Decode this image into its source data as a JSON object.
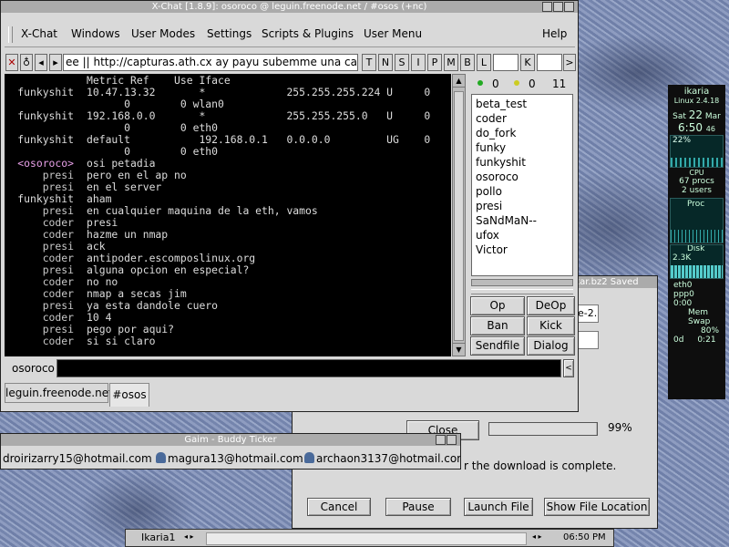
{
  "xchat": {
    "title": "X-Chat [1.8.9]: osoroco @ leguin.freenode.net / #osos (+nc)",
    "menu": [
      "X-Chat",
      "Windows",
      "User Modes",
      "Settings",
      "Scripts & Plugins",
      "User Menu",
      "Help"
    ],
    "topic": "ee || http://capturas.ath.cx ay payu subemme una castural",
    "mode_buttons": [
      "T",
      "N",
      "S",
      "I",
      "P",
      "M",
      "B",
      "L",
      "K"
    ],
    "arrow_right": ">",
    "route_lines": [
      {
        "nick": "",
        "text": "Metric Ref    Use Iface"
      },
      {
        "nick": "funkyshit",
        "text": "10.47.13.32       *             255.255.255.224 U     0"
      },
      {
        "nick": "",
        "text": "      0        0 wlan0"
      },
      {
        "nick": "funkyshit",
        "text": "192.168.0.0       *             255.255.255.0   U     0"
      },
      {
        "nick": "",
        "text": "      0        0 eth0"
      },
      {
        "nick": "funkyshit",
        "text": "default           192.168.0.1   0.0.0.0         UG    0"
      },
      {
        "nick": "",
        "text": "      0        0 eth0"
      }
    ],
    "chat_lines": [
      {
        "nick": "<osoroco>",
        "text": "osi petadia"
      },
      {
        "nick": "presi",
        "text": "pero en el ap no"
      },
      {
        "nick": "presi",
        "text": "en el server"
      },
      {
        "nick": "funkyshit",
        "text": "aham"
      },
      {
        "nick": "presi",
        "text": "en cualquier maquina de la eth, vamos"
      },
      {
        "nick": "coder",
        "text": "presi"
      },
      {
        "nick": "coder",
        "text": "hazme un nmap"
      },
      {
        "nick": "presi",
        "text": "ack"
      },
      {
        "nick": "coder",
        "text": "antipoder.escomposlinux.org"
      },
      {
        "nick": "presi",
        "text": "alguna opcion en especial?"
      },
      {
        "nick": "coder",
        "text": "no no"
      },
      {
        "nick": "coder",
        "text": "nmap a secas jim"
      },
      {
        "nick": "presi",
        "text": "ya esta dandole cuero"
      },
      {
        "nick": "coder",
        "text": "10 4"
      },
      {
        "nick": "presi",
        "text": "pego por aqui?"
      },
      {
        "nick": "coder",
        "text": "si si claro"
      }
    ],
    "ops_count": "0",
    "voice_count": "0",
    "user_count": "11",
    "users": [
      "beta_test",
      "coder",
      "do_fork",
      "funky",
      "funkyshit",
      "osoroco",
      "pollo",
      "presi",
      "SaNdMaN--",
      "ufox",
      "Victor"
    ],
    "user_buttons": [
      "Op",
      "DeOp",
      "Ban",
      "Kick",
      "Sendfile",
      "Dialog"
    ],
    "nick": "osoroco",
    "tabs": [
      "leguin.freenode.net",
      "#osos"
    ]
  },
  "download": {
    "title_fragment": ".tar.bz2 Saved",
    "field1_fragment": "e-2.",
    "close_label": "Close",
    "percent": "99%",
    "progress": 0.99,
    "message": "r the download is complete.",
    "buttons": [
      "Cancel",
      "Pause",
      "Launch File",
      "Show File Location"
    ]
  },
  "gaim": {
    "title": "Gaim - Buddy Ticker",
    "buddies": [
      "droirizarry15@hotmail.com",
      "magura13@hotmail.com",
      "archaon3137@hotmail.com"
    ]
  },
  "conky": {
    "host": "ikaria",
    "kernel": "Linux 2.4.18",
    "day": "Sat",
    "date": "22",
    "month": "Mar",
    "time": "6:50",
    "seconds": "46",
    "cpu_pct": "22%",
    "cpu_label": "CPU",
    "procs": "67 procs",
    "users": "2 users",
    "proc_label": "Proc",
    "disk_label": "Disk",
    "disk_val": "2.3K",
    "if1": "eth0",
    "if2": "ppp0",
    "uptime": "0:00",
    "mem_label": "Mem",
    "swap_label": "Swap",
    "swap_pct": "80%",
    "days": "0d",
    "up": "0:21"
  },
  "taskbar": {
    "desktop": "Ikaria1",
    "clock": "06:50 PM"
  }
}
